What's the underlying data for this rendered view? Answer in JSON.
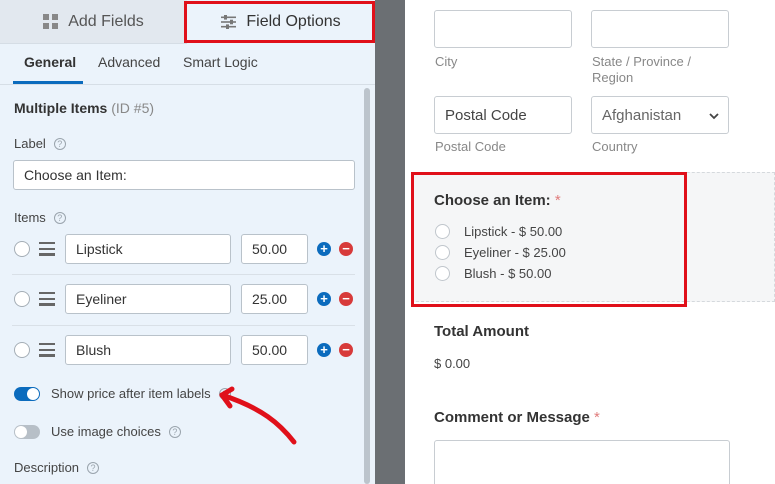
{
  "left_panel": {
    "tabs": {
      "add_fields": "Add Fields",
      "field_options": "Field Options"
    },
    "sub_tabs": {
      "general": "General",
      "advanced": "Advanced",
      "smart_logic": "Smart Logic"
    },
    "field_title": "Multiple Items",
    "field_id": "(ID #5)",
    "label_caption": "Label",
    "label_value": "Choose an Item:",
    "items_caption": "Items",
    "items": [
      {
        "name": "Lipstick",
        "price": "50.00"
      },
      {
        "name": "Eyeliner",
        "price": "25.00"
      },
      {
        "name": "Blush",
        "price": "50.00"
      }
    ],
    "show_price_label": "Show price after item labels",
    "show_price_enabled": true,
    "image_choices_label": "Use image choices",
    "image_choices_enabled": false,
    "description_caption": "Description",
    "help_glyph": "?"
  },
  "right_panel": {
    "city_sub": "City",
    "state_sub_line1": "State / Province /",
    "state_sub_line2": "Region",
    "postal_placeholder": "Postal Code",
    "postal_sub": "Postal Code",
    "country_value": "Afghanistan",
    "country_sub": "Country",
    "choose_title": "Choose an Item:",
    "required_mark": "*",
    "choices": [
      "Lipstick - $ 50.00",
      "Eyeliner - $ 25.00",
      "Blush - $ 50.00"
    ],
    "total_title": "Total Amount",
    "total_value": "$ 0.00",
    "comment_title": "Comment or Message"
  },
  "colors": {
    "highlight": "#e0101a",
    "accent": "#0b6bbd",
    "remove": "#d73a3a",
    "arrow": "#e0101a"
  },
  "icons": [
    "sliders-icon",
    "grid-icon",
    "help-icon",
    "drag-handle-icon",
    "add-item-icon",
    "remove-item-icon",
    "chevron-down-icon",
    "annotation-arrow-icon"
  ]
}
